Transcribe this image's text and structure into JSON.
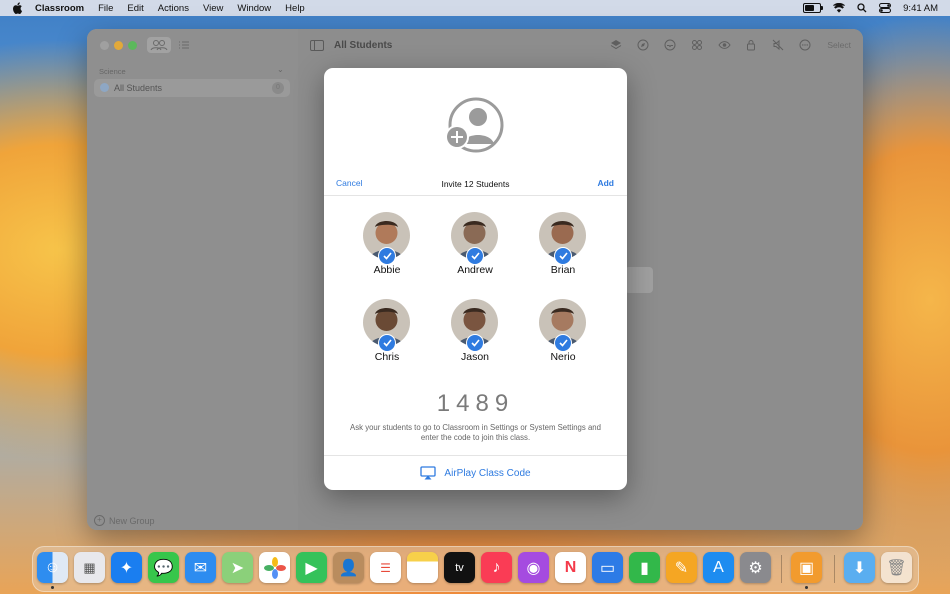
{
  "menubar": {
    "apple_icon": "apple-logo-icon",
    "app_name": "Classroom",
    "menus": [
      "File",
      "Edit",
      "Actions",
      "View",
      "Window",
      "Help"
    ],
    "battery_level": 0.7,
    "time": "9:41 AM"
  },
  "sidebar": {
    "section": "Science",
    "items": [
      {
        "label": "All Students",
        "count": "0"
      }
    ],
    "new_group": "New Group"
  },
  "main": {
    "title": "All Students",
    "select_label": "Select"
  },
  "sheet": {
    "cancel": "Cancel",
    "title": "Invite 12 Students",
    "add": "Add",
    "students": [
      {
        "name": "Abbie",
        "checked": true,
        "color": "#b07a5a"
      },
      {
        "name": "Andrew",
        "checked": true,
        "color": "#8a6a55"
      },
      {
        "name": "Brian",
        "checked": true,
        "color": "#9a6a50"
      },
      {
        "name": "Chris",
        "checked": true,
        "color": "#6a4a35"
      },
      {
        "name": "Jason",
        "checked": true,
        "color": "#7a5540"
      },
      {
        "name": "Nerio",
        "checked": true,
        "color": "#a67a60"
      }
    ],
    "code": "1489",
    "instructions_line1": "Ask your students to go to Classroom in Settings or System Settings and",
    "instructions_line2": "enter the code to join this class.",
    "airplay_label": "AirPlay Class Code"
  },
  "colors": {
    "accent": "#2f7be0"
  }
}
